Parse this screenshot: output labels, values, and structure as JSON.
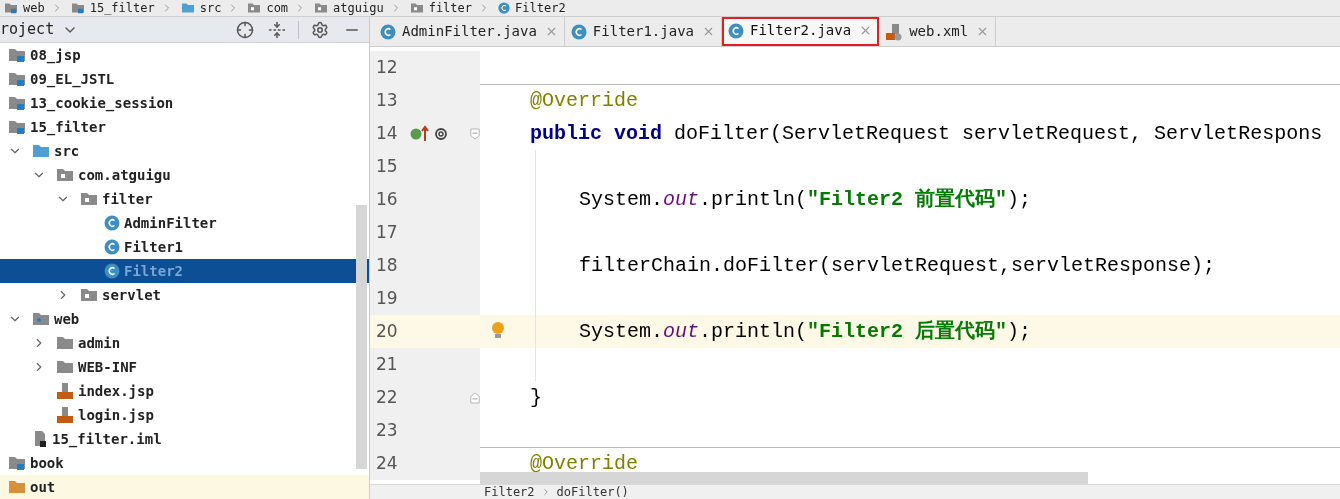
{
  "breadcrumb": [
    {
      "label": "web",
      "kind": "module"
    },
    {
      "label": "15_filter",
      "kind": "module"
    },
    {
      "label": "src",
      "kind": "source-folder"
    },
    {
      "label": "com",
      "kind": "package"
    },
    {
      "label": "atguigu",
      "kind": "package"
    },
    {
      "label": "filter",
      "kind": "package"
    },
    {
      "label": "Filter2",
      "kind": "class"
    }
  ],
  "project_panel": {
    "title": "roject",
    "tree": [
      {
        "label": "08_jsp",
        "kind": "module",
        "selected": false
      },
      {
        "label": "09_EL_JSTL",
        "kind": "module",
        "selected": false
      },
      {
        "label": "13_cookie_session",
        "kind": "module",
        "selected": false
      },
      {
        "label": "15_filter",
        "kind": "module",
        "selected": false,
        "children": [
          {
            "label": "src",
            "kind": "source-folder",
            "expanded": true,
            "selected": false,
            "children": [
              {
                "label": "com.atguigu",
                "kind": "package",
                "expanded": true,
                "selected": false,
                "children": [
                  {
                    "label": "filter",
                    "kind": "package",
                    "expanded": true,
                    "selected": false,
                    "children": [
                      {
                        "label": "AdminFilter",
                        "kind": "class",
                        "selected": false
                      },
                      {
                        "label": "Filter1",
                        "kind": "class",
                        "selected": false
                      },
                      {
                        "label": "Filter2",
                        "kind": "class",
                        "selected": true
                      }
                    ]
                  },
                  {
                    "label": "servlet",
                    "kind": "package",
                    "expanded": false,
                    "selected": false
                  }
                ]
              }
            ]
          },
          {
            "label": "web",
            "kind": "web-folder",
            "expanded": true,
            "selected": false,
            "children": [
              {
                "label": "admin",
                "kind": "folder",
                "expanded": false,
                "selected": false
              },
              {
                "label": "WEB-INF",
                "kind": "folder",
                "expanded": false,
                "selected": false
              },
              {
                "label": "index.jsp",
                "kind": "jsp",
                "selected": false
              },
              {
                "label": "login.jsp",
                "kind": "jsp",
                "selected": false
              }
            ]
          },
          {
            "label": "15_filter.iml",
            "kind": "iml",
            "selected": false
          }
        ]
      },
      {
        "label": "book",
        "kind": "module",
        "selected": false
      },
      {
        "label": "out",
        "kind": "excluded-folder",
        "selected": false
      }
    ]
  },
  "tabs": [
    {
      "label": "AdminFilter.java",
      "kind": "class",
      "selected": false
    },
    {
      "label": "Filter1.java",
      "kind": "class",
      "selected": false
    },
    {
      "label": "Filter2.java",
      "kind": "class",
      "selected": true
    },
    {
      "label": "web.xml",
      "kind": "xml",
      "selected": false
    }
  ],
  "editor": {
    "lines": [
      {
        "number": "12"
      },
      {
        "number": "13",
        "separator_above": true,
        "tokens": [
          {
            "kind": "annotation",
            "text": "@Override"
          }
        ]
      },
      {
        "number": "14",
        "override_marker": true,
        "fold_start": true,
        "tokens": [
          {
            "kind": "keyword",
            "text": "public void"
          },
          {
            "kind": "plain",
            "text": " doFilter(ServletRequest servletRequest, ServletRespons"
          }
        ]
      },
      {
        "number": "15",
        "indented": true
      },
      {
        "number": "16",
        "indented": true,
        "tokens": [
          {
            "kind": "plain",
            "text": "System."
          },
          {
            "kind": "static",
            "text": "out"
          },
          {
            "kind": "plain",
            "text": ".println("
          },
          {
            "kind": "string",
            "text": "\"Filter2 前置代码\""
          },
          {
            "kind": "plain",
            "text": ");"
          }
        ]
      },
      {
        "number": "17",
        "indented": true
      },
      {
        "number": "18",
        "indented": true,
        "tokens": [
          {
            "kind": "plain",
            "text": "filterChain.doFilter(servletRequest,servletResponse);"
          }
        ]
      },
      {
        "number": "19",
        "indented": true
      },
      {
        "number": "20",
        "indented": true,
        "current": true,
        "bulb": true,
        "tokens": [
          {
            "kind": "plain",
            "text": "System."
          },
          {
            "kind": "static",
            "text": "out"
          },
          {
            "kind": "plain",
            "text": ".println("
          },
          {
            "kind": "string",
            "text": "\"Filter2 后置代码\""
          },
          {
            "kind": "plain",
            "text": ");"
          }
        ]
      },
      {
        "number": "21",
        "indented": true
      },
      {
        "number": "22",
        "fold_end": true,
        "tokens": [
          {
            "kind": "plain",
            "text": "}"
          }
        ]
      },
      {
        "number": "23"
      },
      {
        "number": "24",
        "separator_above": true,
        "tokens": [
          {
            "kind": "annotation",
            "text": "@Override"
          }
        ]
      }
    ],
    "breadcrumb": [
      "Filter2",
      "doFilter()"
    ]
  }
}
